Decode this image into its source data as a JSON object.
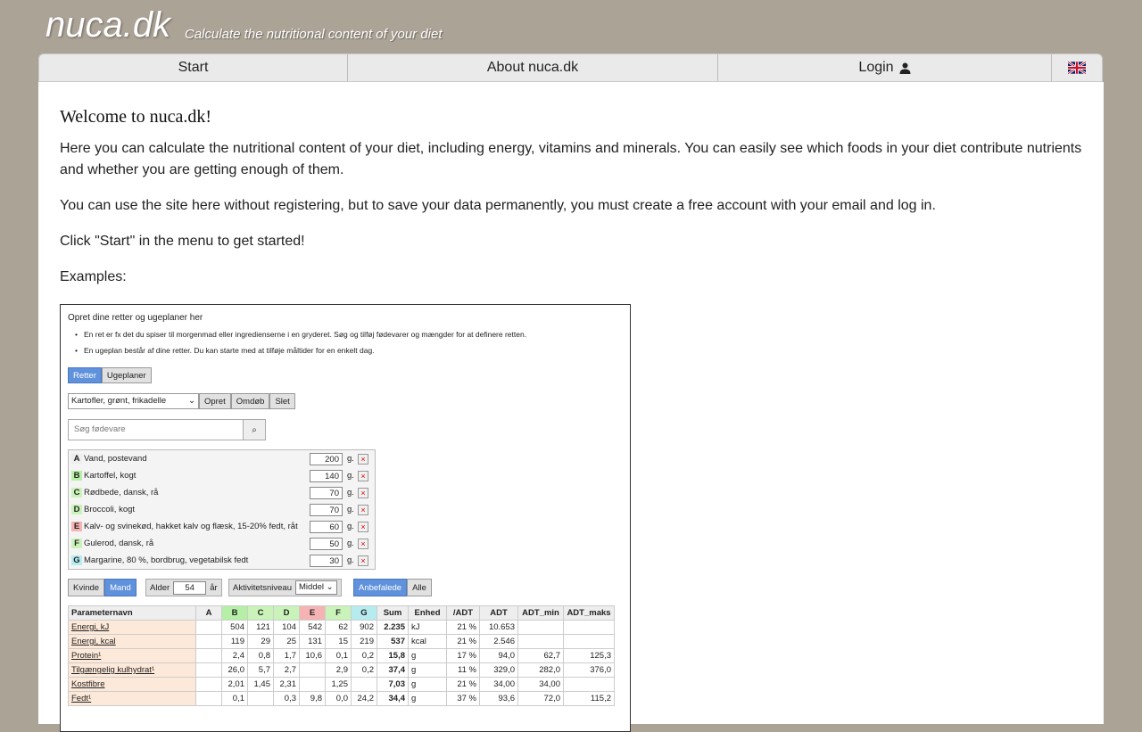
{
  "brand": {
    "name": "nuca.dk",
    "tagline": "Calculate the nutritional content of your diet"
  },
  "nav": {
    "items": [
      {
        "label": "Start"
      },
      {
        "label": "About nuca.dk"
      },
      {
        "label": "Login"
      }
    ],
    "flag_icon": "uk-flag-icon",
    "user_icon": "user-icon"
  },
  "main": {
    "title": "Welcome to nuca.dk!",
    "paragraphs": [
      "Here you can calculate the nutritional content of your diet, including energy, vitamins and minerals. You can easily see which foods in your diet contribute nutrients and whether you are getting enough of them.",
      "You can use the site here without registering, but to save your data permanently, you must create a free account with your email and log in.",
      "Click \"Start\" in the menu to get started!",
      "Examples:"
    ]
  },
  "example": {
    "intro": "Opret dine retter og ugeplaner her",
    "bullets": [
      "En ret er fx det du spiser til morgenmad eller ingredienserne i en gryderet. Søg og tilføj fødevarer og mængder for at definere retten.",
      "En ugeplan består af dine retter. Du kan starte med at tilføje måltider for en enkelt dag."
    ],
    "tabs": [
      "Retter",
      "Ugeplaner"
    ],
    "dish_select": "Kartofler, grønt, frikadelle",
    "dish_buttons": [
      "Opret",
      "Omdøb",
      "Slet"
    ],
    "search_placeholder": "Søg fødevare",
    "foods": [
      {
        "letter": "A",
        "name": "Vand, postevand",
        "amount": "200",
        "unit": "g.",
        "color": "#eeeeee"
      },
      {
        "letter": "B",
        "name": "Kartoffel, kogt",
        "amount": "140",
        "unit": "g.",
        "color": "#b6f0a6"
      },
      {
        "letter": "C",
        "name": "Rødbede, dansk, rå",
        "amount": "70",
        "unit": "g.",
        "color": "#c9f3b8"
      },
      {
        "letter": "D",
        "name": "Broccoli, kogt",
        "amount": "70",
        "unit": "g.",
        "color": "#c9f3b8"
      },
      {
        "letter": "E",
        "name": "Kalv- og svinekød, hakket kalv og flæsk, 15-20% fedt, råt",
        "amount": "60",
        "unit": "g.",
        "color": "#f6b3b3"
      },
      {
        "letter": "F",
        "name": "Gulerod, dansk, rå",
        "amount": "50",
        "unit": "g.",
        "color": "#c9f3b8"
      },
      {
        "letter": "G",
        "name": "Margarine, 80 %, bordbrug, vegetabilsk fedt",
        "amount": "30",
        "unit": "g.",
        "color": "#b6ecef"
      }
    ],
    "gender": [
      "Kvinde",
      "Mand"
    ],
    "age_label": "Alder",
    "age_value": "54",
    "age_unit": "år",
    "activity_label": "Aktivitetsniveau",
    "activity_value": "Middel",
    "rec_buttons": [
      "Anbefalede",
      "Alle"
    ],
    "table_headers": [
      "Parameternavn",
      "A",
      "B",
      "C",
      "D",
      "E",
      "F",
      "G",
      "Sum",
      "Enhed",
      "/ADT",
      "ADT",
      "ADT_min",
      "ADT_maks"
    ],
    "header_colors": [
      "#eeeeee",
      "#eeeeee",
      "#b6f0a6",
      "#c9f3b8",
      "#c9f3b8",
      "#f6b3b3",
      "#c9f3b8",
      "#b6ecef",
      "#eeeeee",
      "#eeeeee",
      "#eeeeee",
      "#eeeeee",
      "#eeeeee",
      "#eeeeee"
    ],
    "rows": [
      [
        "Energi, kJ",
        "",
        "504",
        "121",
        "104",
        "542",
        "62",
        "902",
        "2.235",
        "kJ",
        "21 %",
        "10.653",
        "",
        ""
      ],
      [
        "Energi, kcal",
        "",
        "119",
        "29",
        "25",
        "131",
        "15",
        "219",
        "537",
        "kcal",
        "21 %",
        "2.546",
        "",
        ""
      ],
      [
        "Protein¹",
        "",
        "2,4",
        "0,8",
        "1,7",
        "10,6",
        "0,1",
        "0,2",
        "15,8",
        "g",
        "17 %",
        "94,0",
        "62,7",
        "125,3"
      ],
      [
        "Tilgængelig kulhydrat¹",
        "",
        "26,0",
        "5,7",
        "2,7",
        "",
        "2,9",
        "0,2",
        "37,4",
        "g",
        "11 %",
        "329,0",
        "282,0",
        "376,0"
      ],
      [
        "Kostfibre",
        "",
        "2,01",
        "1,45",
        "2,31",
        "",
        "1,25",
        "",
        "7,03",
        "g",
        "21 %",
        "34,00",
        "34,00",
        ""
      ],
      [
        "Fedt¹",
        "",
        "0,1",
        "",
        "0,3",
        "9,8",
        "0,0",
        "24,2",
        "34,4",
        "g",
        "37 %",
        "93,6",
        "72,0",
        "115,2"
      ]
    ]
  }
}
